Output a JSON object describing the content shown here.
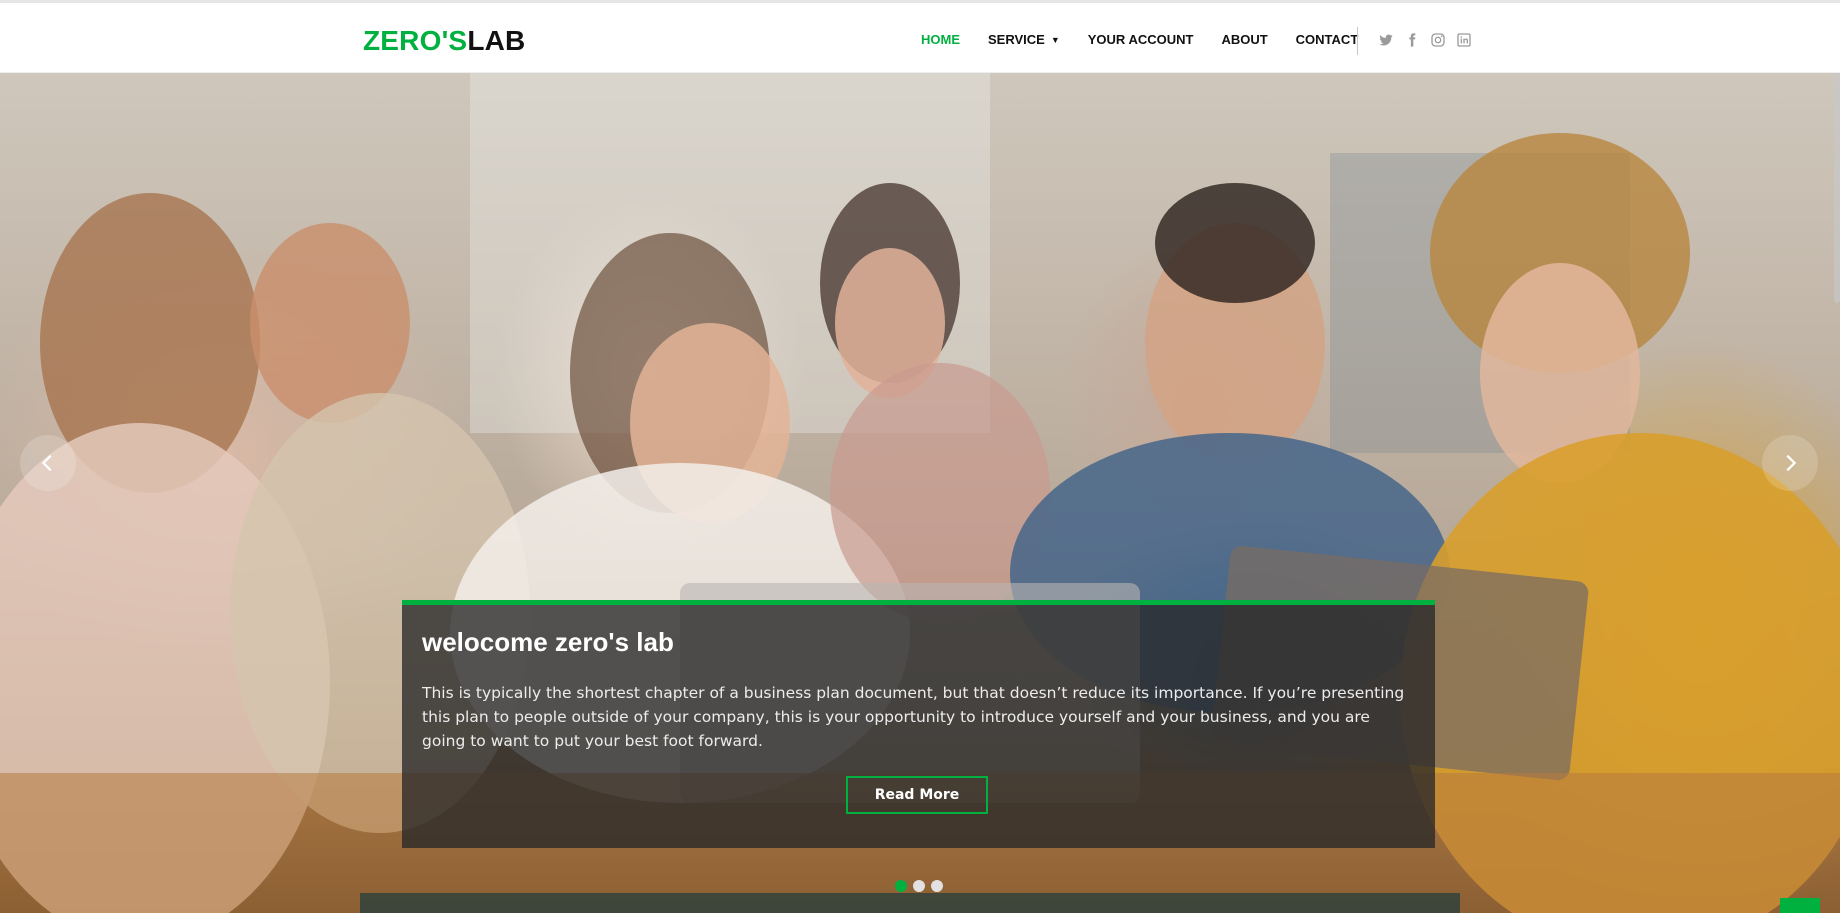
{
  "brand": {
    "part1": "ZERO'S",
    "part2": "LAB"
  },
  "nav": {
    "items": [
      {
        "label": "HOME",
        "active": true
      },
      {
        "label": "SERVICE",
        "has_dropdown": true
      },
      {
        "label": "YOUR ACCOUNT"
      },
      {
        "label": "ABOUT"
      },
      {
        "label": "CONTACT"
      }
    ],
    "social_icons": [
      "twitter-icon",
      "facebook-icon",
      "instagram-icon",
      "linkedin-icon"
    ]
  },
  "hero": {
    "title": "welocome zero's lab",
    "text": "This is typically the shortest chapter of a business plan document, but that doesn’t reduce its importance. If you’re presenting this plan to people outside of your company, this is your opportunity to introduce yourself and your business, and you are going to want to put your best foot forward.",
    "button_label": "Read More",
    "slide_count": 3,
    "active_slide": 1
  },
  "colors": {
    "accent": "#00b140",
    "caption_bg": "#282828",
    "text_dark": "#111111"
  }
}
